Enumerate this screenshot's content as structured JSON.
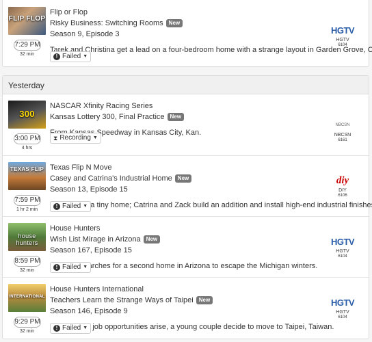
{
  "section_yesterday": "Yesterday",
  "items": [
    {
      "show": "Flip or Flop",
      "thumb_text": "FLIP FLOP",
      "episode": "Risky Business: Switching Rooms",
      "badge": "New",
      "season": "Season 9, Episode 3",
      "description": "Tarek and Christina get a lead on a four-bedroom home with a strange layout in Garden Grove, Calif.",
      "time": "7:29 PM",
      "duration": "32 min",
      "status": "Failed",
      "status_icon": "exclamation-icon",
      "channel_logo": "HGTV",
      "channel_name": "HGTV",
      "channel_number": "6104"
    },
    {
      "show": "NASCAR Xfinity Racing Series",
      "thumb_text": "300",
      "episode": "Kansas Lottery 300, Final Practice",
      "badge": "New",
      "season": "",
      "description": "From Kansas Speedway in Kansas City, Kan.",
      "time": "3:00 PM",
      "duration": "4 hrs",
      "status": "Recording",
      "status_icon": "hourglass-icon",
      "channel_logo": "NBCSN",
      "channel_name": "NBCSN",
      "channel_number": "6161"
    },
    {
      "show": "Texas Flip N Move",
      "thumb_text": "TEXAS FLIP",
      "episode": "Casey and Catrina's Industrial Home",
      "badge": "New",
      "season": "Season 13, Episode 15",
      "description": "Casey wins a tiny home; Catrina and Zack build an addition and install high-end industrial finishes.",
      "time": "7:59 PM",
      "duration": "1 hr 2 min",
      "status": "Failed",
      "status_icon": "exclamation-icon",
      "channel_logo": "diy",
      "channel_name": "DIY",
      "channel_number": "6106"
    },
    {
      "show": "House Hunters",
      "thumb_text": "house hunters",
      "episode": "Wish List Mirage in Arizona",
      "badge": "New",
      "season": "Season 167, Episode 15",
      "description": "A broker searches for a second home in Arizona to escape the Michigan winters.",
      "time": "8:59 PM",
      "duration": "32 min",
      "status": "Failed",
      "status_icon": "exclamation-icon",
      "channel_logo": "HGTV",
      "channel_name": "HGTV",
      "channel_number": "6104"
    },
    {
      "show": "House Hunters International",
      "thumb_text": "INTERNATIONAL",
      "episode": "Teachers Learn the Strange Ways of Taipei",
      "badge": "New",
      "season": "Season 146, Episode 9",
      "description": "After mutual job opportunities arise, a young couple decide to move to Taipei, Taiwan.",
      "time": "9:29 PM",
      "duration": "32 min",
      "status": "Failed",
      "status_icon": "exclamation-icon",
      "channel_logo": "HGTV",
      "channel_name": "HGTV",
      "channel_number": "6104"
    }
  ]
}
